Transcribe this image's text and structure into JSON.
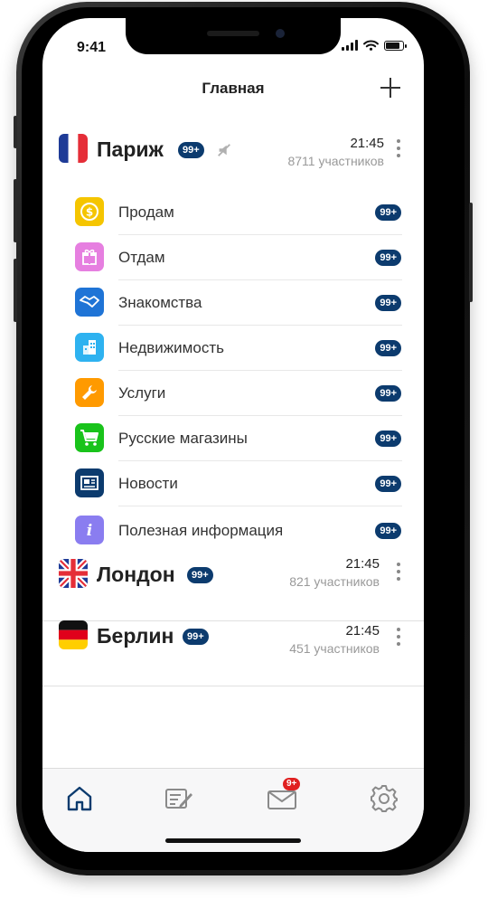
{
  "status_bar": {
    "time": "9:41"
  },
  "header": {
    "title": "Главная"
  },
  "badge_text": "99+",
  "groups": [
    {
      "name": "Париж",
      "time": "21:45",
      "members": "8711 участников",
      "muted": true,
      "items": [
        {
          "label": "Продам",
          "icon": "dollar-coin-icon",
          "color": "#f5c500"
        },
        {
          "label": "Отдам",
          "icon": "gift-icon",
          "color": "#e67fe0"
        },
        {
          "label": "Знакомства",
          "icon": "handshake-icon",
          "color": "#1f74d6"
        },
        {
          "label": "Недвижимость",
          "icon": "building-icon",
          "color": "#2eb2f0"
        },
        {
          "label": "Услуги",
          "icon": "wrench-icon",
          "color": "#ff9a00"
        },
        {
          "label": "Русские магазины",
          "icon": "shopping-cart-icon",
          "color": "#19c31b"
        },
        {
          "label": "Новости",
          "icon": "newspaper-icon",
          "color": "#0c3b6e"
        },
        {
          "label": "Полезная информация",
          "icon": "info-icon",
          "color": "#8a7df0"
        }
      ]
    },
    {
      "name": "Лондон",
      "time": "21:45",
      "members": "821 участников",
      "muted": false
    },
    {
      "name": "Берлин",
      "time": "21:45",
      "members": "451 участников",
      "muted": false
    }
  ],
  "tabs": [
    {
      "name": "home",
      "icon": "home-icon",
      "active": true,
      "color": "#0c3b6e"
    },
    {
      "name": "posts",
      "icon": "edit-note-icon",
      "active": false,
      "color": "#8a8a8a"
    },
    {
      "name": "messages",
      "icon": "envelope-icon",
      "active": false,
      "badge": "9+",
      "color": "#8a8a8a"
    },
    {
      "name": "settings",
      "icon": "gear-icon",
      "active": false,
      "color": "#8a8a8a"
    }
  ]
}
